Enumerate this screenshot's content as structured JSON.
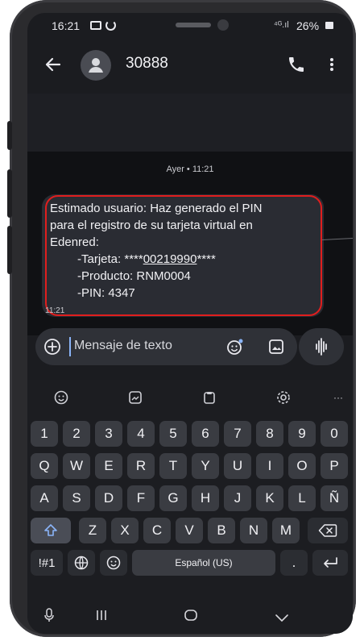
{
  "status_bar": {
    "time": "16:21",
    "signal": "⁴ᴳ.ıl",
    "battery": "26%"
  },
  "header": {
    "contact": "30888"
  },
  "conversation": {
    "date_label": "Ayer • 11:21",
    "message_lines": [
      "Estimado usuario: Haz generado el PIN",
      "para el registro de su tarjeta virtual en",
      "Edenred:"
    ],
    "tarjeta_prefix": "-Tarjeta: ****",
    "tarjeta_number": "00219990",
    "tarjeta_suffix": "****",
    "producto": "-Producto: RNM0004",
    "pin": "-PIN: 4347",
    "time": "11:21"
  },
  "composer": {
    "placeholder": "Mensaje de texto"
  },
  "keyboard": {
    "row_numbers": [
      "1",
      "2",
      "3",
      "4",
      "5",
      "6",
      "7",
      "8",
      "9",
      "0"
    ],
    "row_1": [
      "Q",
      "W",
      "E",
      "R",
      "T",
      "Y",
      "U",
      "I",
      "O",
      "P"
    ],
    "row_2": [
      "A",
      "S",
      "D",
      "F",
      "G",
      "H",
      "J",
      "K",
      "L",
      "Ñ"
    ],
    "row_3": [
      "Z",
      "X",
      "C",
      "V",
      "B",
      "N",
      "M"
    ],
    "symbols": "!#1",
    "space": "Español (US)",
    "period": ".",
    "more": "···"
  },
  "icons": {
    "back": "arrow-left",
    "avatar": "person",
    "call": "phone",
    "menu": "dots-vertical",
    "add": "plus-circle",
    "emoji_picker": "smiley",
    "gallery": "image",
    "voice": "waveform",
    "shift": "shift-arrow",
    "backspace": "backspace",
    "enter": "return-arrow"
  }
}
